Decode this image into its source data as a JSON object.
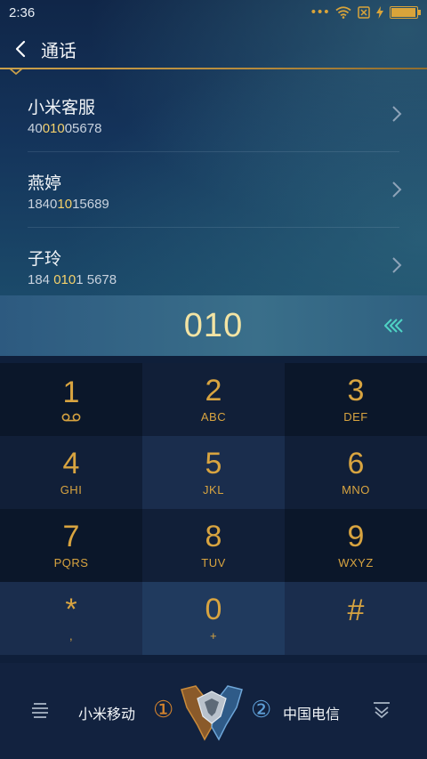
{
  "status": {
    "time": "2:36",
    "battery_level": 0.95
  },
  "header": {
    "title": "通话"
  },
  "contacts": [
    {
      "name": "小米客服",
      "number_pre": "40",
      "number_hl": "010",
      "number_post": "05678"
    },
    {
      "name": "燕婷",
      "number_pre": "1840",
      "number_hl": "10",
      "number_post": "15689"
    },
    {
      "name": "子玲",
      "number_pre": "184 ",
      "number_hl": "010",
      "number_post": "1 5678"
    }
  ],
  "dialed_number": "010",
  "keypad": [
    {
      "digit": "1",
      "letters": ""
    },
    {
      "digit": "2",
      "letters": "ABC"
    },
    {
      "digit": "3",
      "letters": "DEF"
    },
    {
      "digit": "4",
      "letters": "GHI"
    },
    {
      "digit": "5",
      "letters": "JKL"
    },
    {
      "digit": "6",
      "letters": "MNO"
    },
    {
      "digit": "7",
      "letters": "PQRS"
    },
    {
      "digit": "8",
      "letters": "TUV"
    },
    {
      "digit": "9",
      "letters": "WXYZ"
    },
    {
      "digit": "*",
      "letters": ","
    },
    {
      "digit": "0",
      "letters": "+"
    },
    {
      "digit": "#",
      "letters": ""
    }
  ],
  "bottom": {
    "sim1_label": "小米移动",
    "sim1_index": "①",
    "sim2_index": "②",
    "sim2_label": "中国电信"
  },
  "colors": {
    "accent_gold": "#d8a440",
    "highlight_yellow": "#f5d16a",
    "sim1_orange": "#d6842d",
    "sim2_blue": "#5fa0d8"
  },
  "icons": [
    "wifi-icon",
    "sim-off-icon",
    "charging-icon",
    "battery-icon",
    "back-icon",
    "chevron-right-icon",
    "backspace-icon",
    "voicemail-icon",
    "menu-icon",
    "emblem-icon",
    "hide-keypad-icon"
  ]
}
